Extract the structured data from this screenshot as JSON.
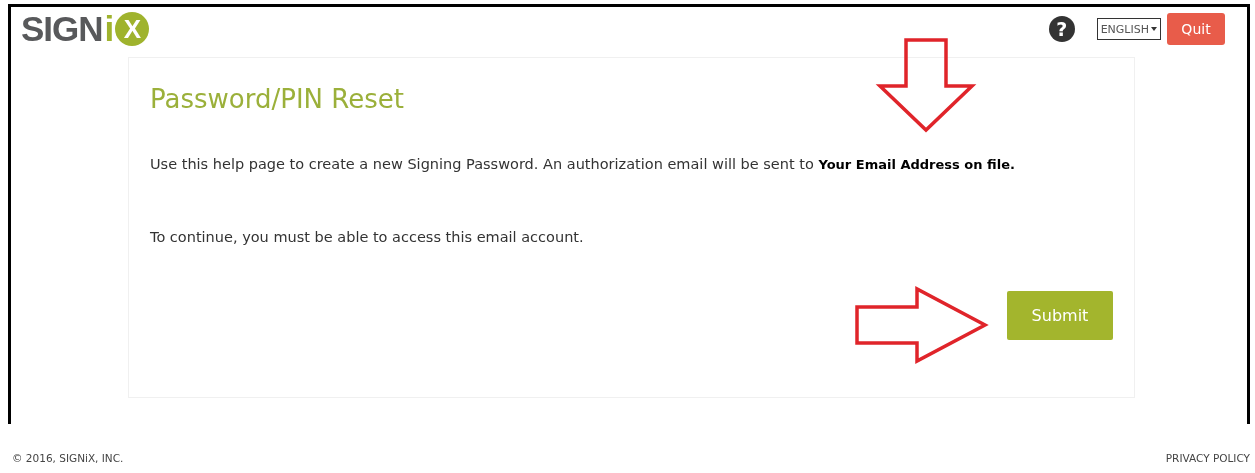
{
  "header": {
    "logo": {
      "word": "SIGN",
      "letter_i": "i",
      "letter_x": "X"
    },
    "help_label": "?",
    "language": "ENGLISH",
    "quit_button": "Quit"
  },
  "card": {
    "title": "Password/PIN Reset",
    "intro": "Use this help page to create a new Signing Password. An authorization email will be sent to **Your Email Address on file.**",
    "notice": "To continue, you must be able to access this email account.",
    "submit_button": "Submit"
  },
  "annotations": [
    {
      "kind": "down-arrow"
    },
    {
      "kind": "right-arrow"
    }
  ],
  "footer": {
    "copyright": "© 2016, SIGNiX, INC.",
    "privacy_link": "PRIVACY POLICY"
  }
}
